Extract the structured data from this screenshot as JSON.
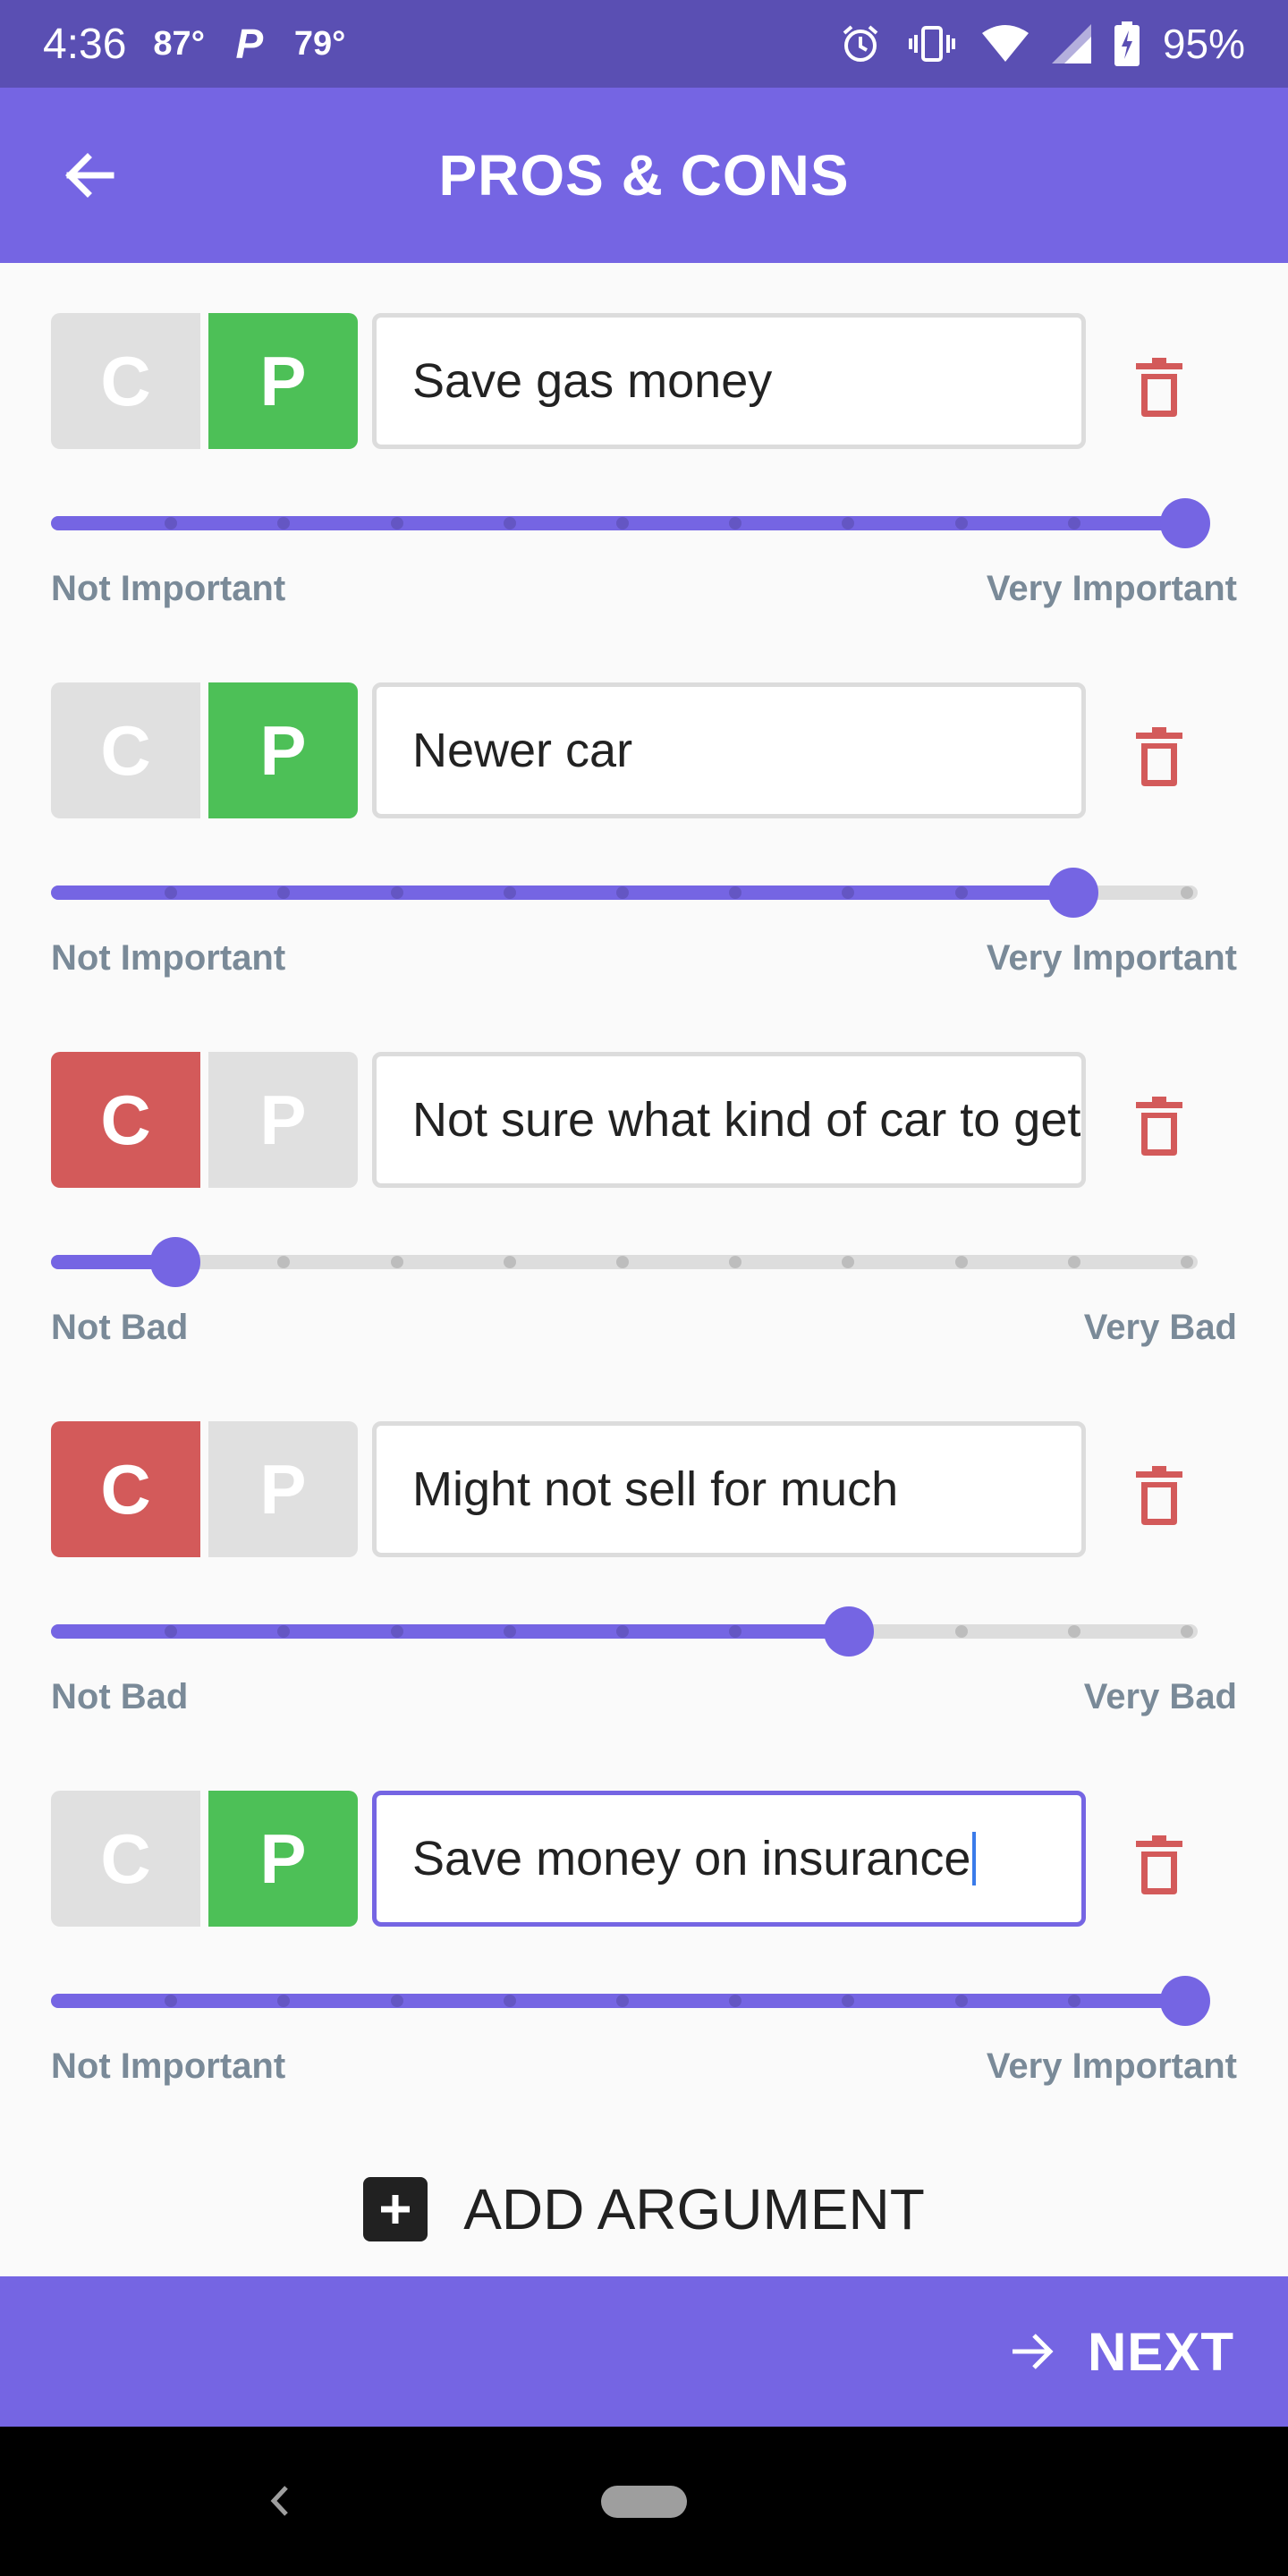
{
  "status_bar": {
    "time": "4:36",
    "temp1": "87°",
    "temp2": "79°",
    "battery": "95%"
  },
  "app_bar": {
    "title": "PROS & CONS"
  },
  "toggle_labels": {
    "con": "C",
    "pro": "P"
  },
  "arguments": [
    {
      "type": "pro",
      "text": "Save gas money",
      "importance": 1.0,
      "min_label": "Not Important",
      "max_label": "Very Important",
      "focused": false
    },
    {
      "type": "pro",
      "text": "Newer car",
      "importance": 0.9,
      "min_label": "Not Important",
      "max_label": "Very Important",
      "focused": false
    },
    {
      "type": "con",
      "text": "Not sure what kind of car to get",
      "importance": 0.1,
      "min_label": "Not Bad",
      "max_label": "Very Bad",
      "focused": false
    },
    {
      "type": "con",
      "text": "Might not sell for much",
      "importance": 0.7,
      "min_label": "Not Bad",
      "max_label": "Very Bad",
      "focused": false
    },
    {
      "type": "pro",
      "text": "Save money on insurance",
      "importance": 1.0,
      "min_label": "Not Important",
      "max_label": "Very Important",
      "focused": true
    }
  ],
  "add_argument": {
    "label": "ADD ARGUMENT"
  },
  "next": {
    "label": "NEXT"
  },
  "colors": {
    "accent": "#7565E3",
    "status_bar": "#5A4FB3",
    "pro": "#4DC057",
    "con": "#D35A5A",
    "inactive": "#E0E0E0"
  },
  "icons": {
    "back": "arrow-left-icon",
    "delete": "trash-icon",
    "add": "plus-square-icon",
    "next": "arrow-right-icon"
  }
}
